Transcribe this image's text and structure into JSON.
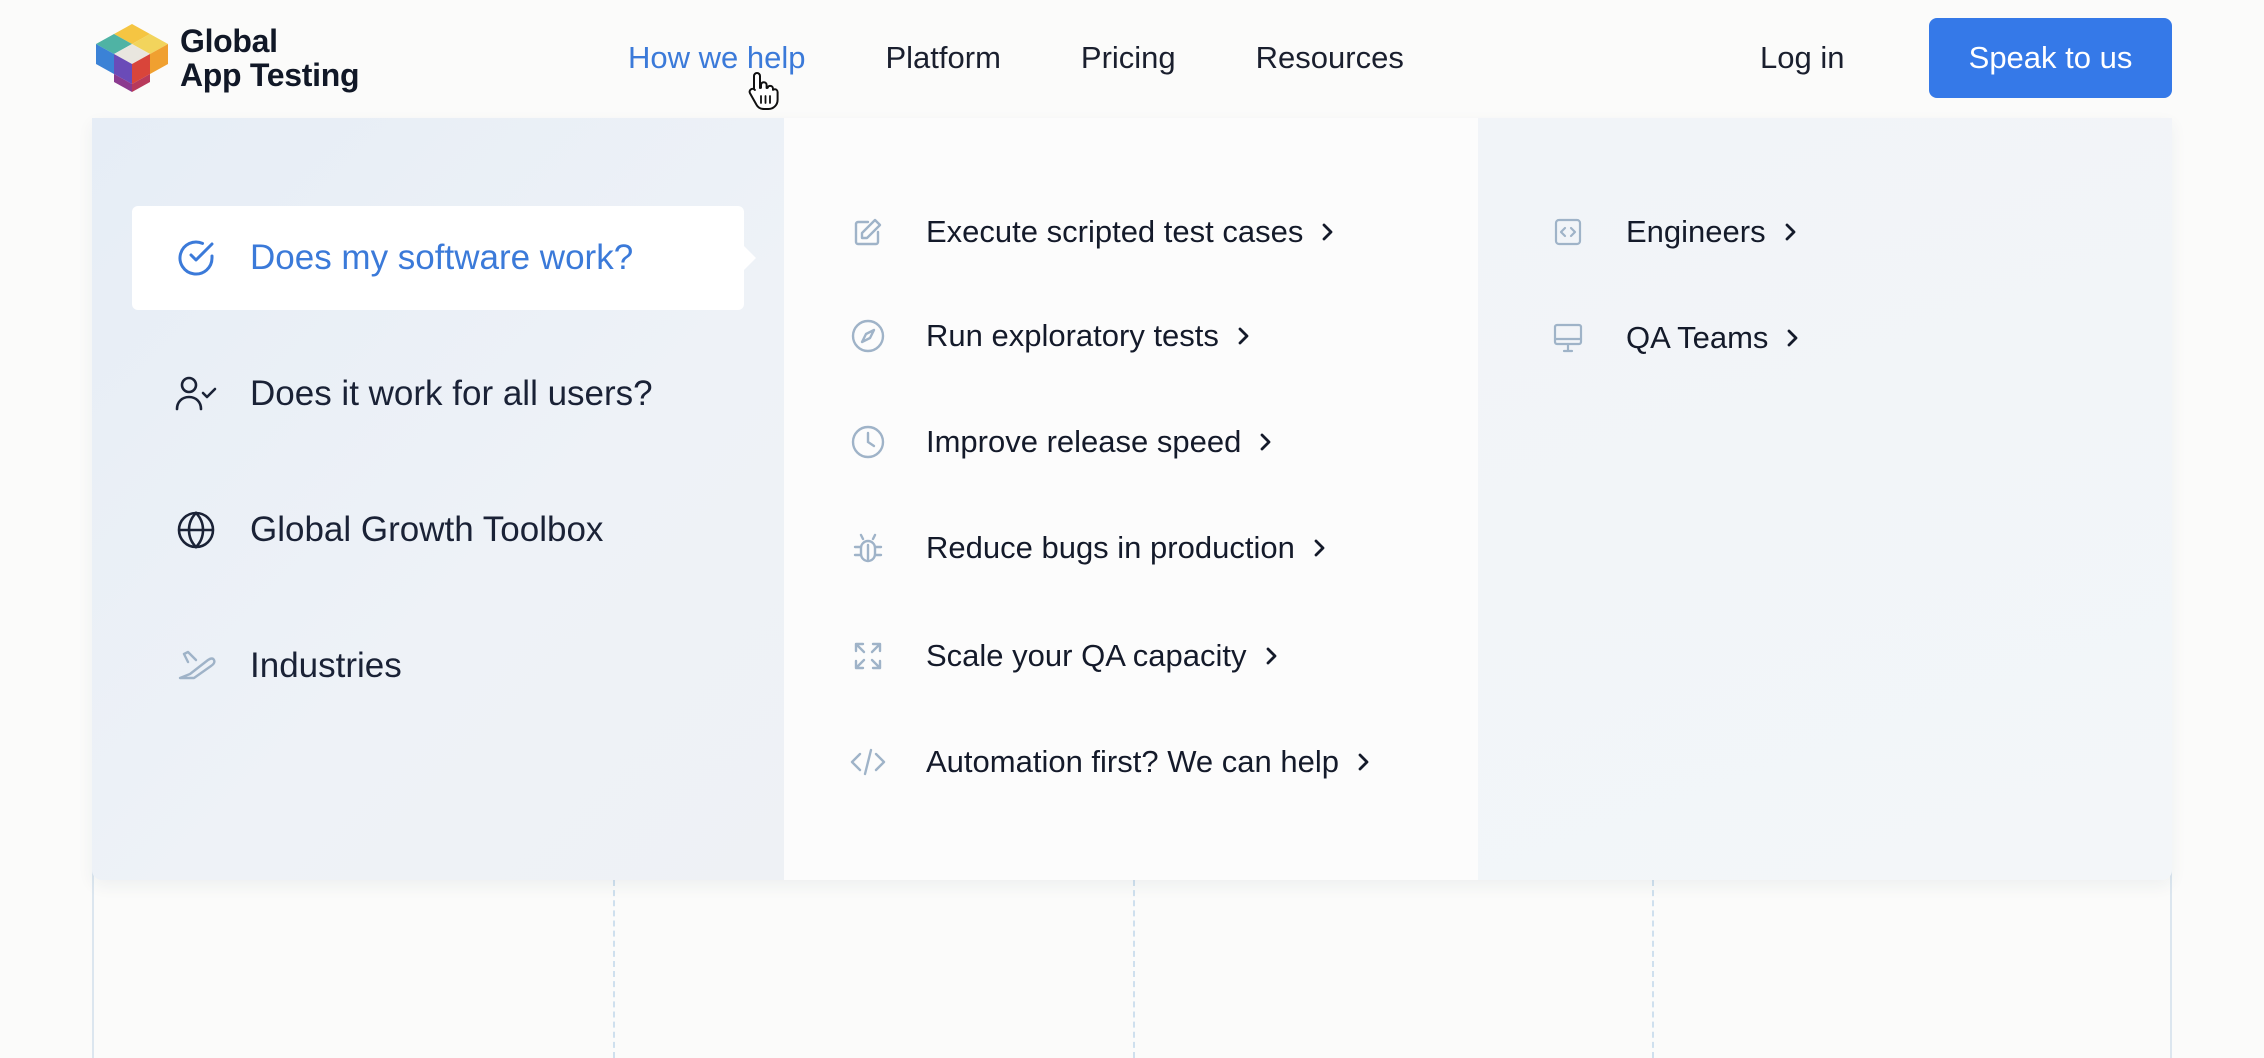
{
  "brand": {
    "line1": "Global",
    "line2": "App Testing"
  },
  "nav": [
    {
      "label": "How we help",
      "active": true
    },
    {
      "label": "Platform"
    },
    {
      "label": "Pricing"
    },
    {
      "label": "Resources"
    }
  ],
  "actions": {
    "login": "Log in",
    "cta": "Speak to us"
  },
  "colors": {
    "accent": "#3b7ad9",
    "cta": "#3579e8",
    "text": "#1a1f2e",
    "icon": "#9fb3c8"
  },
  "menu": {
    "categories": [
      {
        "label": "Does my software work?",
        "icon": "check-circle-icon",
        "active": true
      },
      {
        "label": "Does it work for all users?",
        "icon": "user-check-icon"
      },
      {
        "label": "Global Growth Toolbox",
        "icon": "globe-icon"
      },
      {
        "label": "Industries",
        "icon": "plane-icon"
      }
    ],
    "solutions": [
      {
        "label": "Execute scripted test cases",
        "icon": "pencil-icon"
      },
      {
        "label": "Run exploratory tests",
        "icon": "compass-icon"
      },
      {
        "label": "Improve release speed",
        "icon": "clock-icon"
      },
      {
        "label": "Reduce bugs in production",
        "icon": "bug-icon"
      },
      {
        "label": "Scale your QA capacity",
        "icon": "expand-icon"
      },
      {
        "label": "Automation first? We can help",
        "icon": "code-icon"
      }
    ],
    "audiences": [
      {
        "label": "Engineers",
        "icon": "code-box-icon"
      },
      {
        "label": "QA Teams",
        "icon": "monitor-icon"
      }
    ]
  }
}
